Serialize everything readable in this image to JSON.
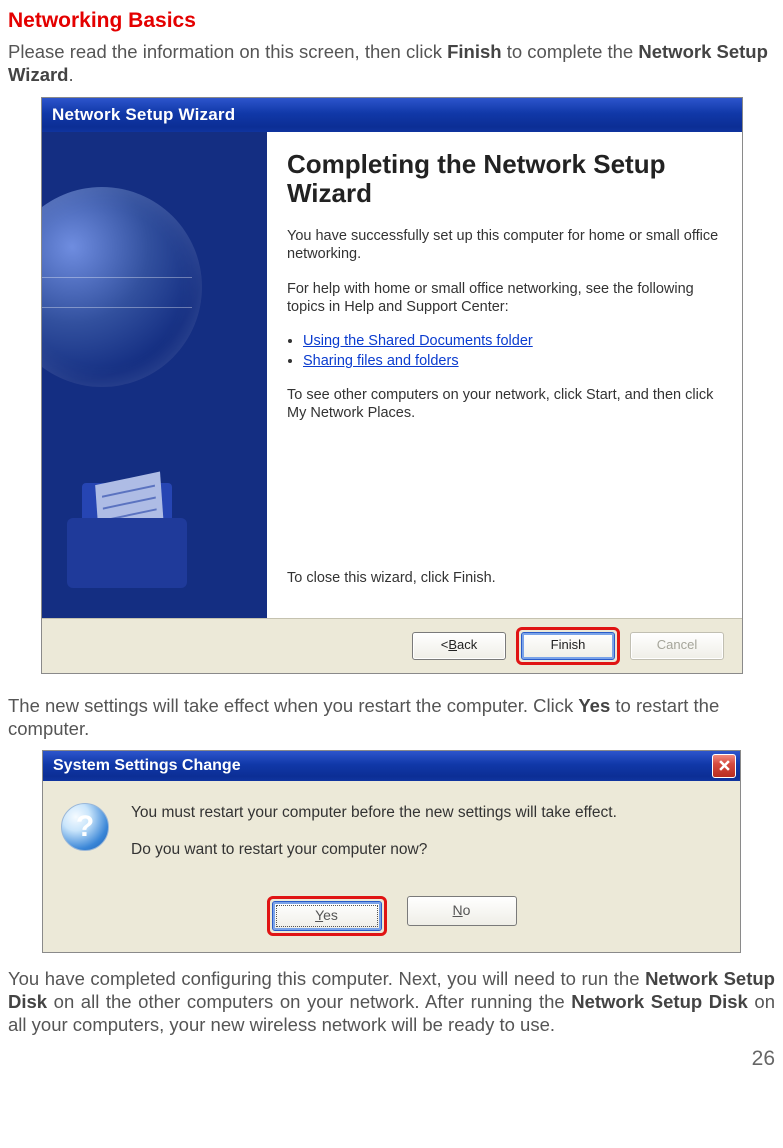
{
  "page": {
    "heading": "Networking Basics",
    "intro_a": "Please read the information on this screen, then click ",
    "intro_b": "Finish",
    "intro_c": " to complete the ",
    "intro_d": "Network Setup Wizard",
    "intro_e": ".",
    "mid_a": "The new settings will take effect when you restart the computer.  Click ",
    "mid_b": "Yes",
    "mid_c": " to restart the computer.",
    "out_a": "You have completed configuring this computer.  Next, you will need to run the ",
    "out_b": "Network Setup Disk",
    "out_c": " on all the other computers on your network.  After running the ",
    "out_d": "Network Setup Disk",
    "out_e": " on all your computers, your new wireless network will be ready to use.",
    "number": "26"
  },
  "wizard": {
    "titlebar": "Network Setup Wizard",
    "heading": "Completing the Network Setup Wizard",
    "p1": "You have successfully set up this computer for home or small office networking.",
    "p2": "For help with home or small office networking, see the following topics in Help and Support Center:",
    "link1": "Using the Shared Documents folder",
    "link2": "Sharing files and folders",
    "p3": "To see other computers on your network, click Start, and then click My Network Places.",
    "close": "To close this wizard, click Finish.",
    "buttons": {
      "back_prefix": "< ",
      "back_ul": "B",
      "back_suffix": "ack",
      "finish": "Finish",
      "cancel": "Cancel"
    }
  },
  "dialog": {
    "titlebar": "System Settings Change",
    "line1": "You must restart your computer before the new settings will take effect.",
    "line2": "Do you want to restart your computer now?",
    "yes_ul": "Y",
    "yes_suffix": "es",
    "no_ul": "N",
    "no_suffix": "o"
  }
}
